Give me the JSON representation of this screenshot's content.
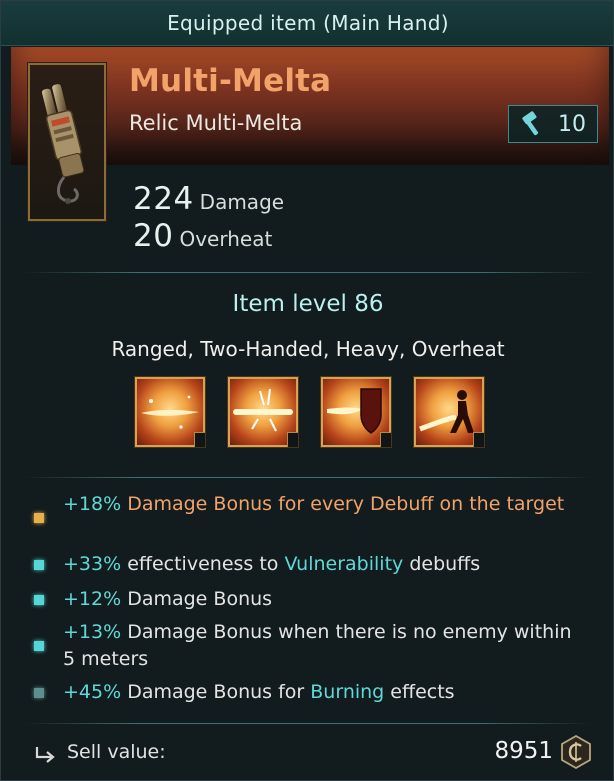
{
  "header": {
    "title": "Equipped item (Main Hand)"
  },
  "item": {
    "name": "Multi-Melta",
    "subtitle": "Relic Multi-Melta",
    "tier_icon": "hammer-icon",
    "tier_value": "10"
  },
  "stats": [
    {
      "value": "224",
      "label": "Damage"
    },
    {
      "value": "20",
      "label": "Overheat"
    }
  ],
  "item_level": "Item level 86",
  "keywords": "Ranged, Two-Handed, Heavy, Overheat",
  "abilities": [
    {
      "icon": "flame-beam-ability-icon"
    },
    {
      "icon": "flame-burst-ability-icon"
    },
    {
      "icon": "flame-shield-ability-icon"
    },
    {
      "icon": "flame-figure-ability-icon"
    }
  ],
  "bonuses": [
    {
      "bullet_color": "#e8b04a",
      "parts": [
        {
          "text": "+18%",
          "style": "teal"
        },
        {
          "text": " Damage Bonus for every Debuff on the target",
          "style": "orange"
        }
      ]
    },
    {
      "bullet_color": "#57d6d6",
      "parts": [
        {
          "text": "+33%",
          "style": "teal"
        },
        {
          "text": " effectiveness to ",
          "style": "plain"
        },
        {
          "text": "Vulnerability",
          "style": "teal"
        },
        {
          "text": " debuffs",
          "style": "plain"
        }
      ]
    },
    {
      "bullet_color": "#57d6d6",
      "parts": [
        {
          "text": "+12%",
          "style": "teal"
        },
        {
          "text": " Damage Bonus",
          "style": "plain"
        }
      ]
    },
    {
      "bullet_color": "#57d6d6",
      "parts": [
        {
          "text": "+13%",
          "style": "teal"
        },
        {
          "text": " Damage Bonus when there is no enemy within 5 meters",
          "style": "plain"
        }
      ]
    },
    {
      "bullet_color": "#5e8f8f",
      "parts": [
        {
          "text": "+45%",
          "style": "teal"
        },
        {
          "text": " Damage Bonus for ",
          "style": "plain"
        },
        {
          "text": "Burning",
          "style": "teal"
        },
        {
          "text": " effects",
          "style": "plain"
        }
      ]
    }
  ],
  "sell": {
    "label": "Sell value:",
    "value": "8951",
    "icon": "sell-arrow-icon",
    "currency_icon": "coin-icon"
  }
}
